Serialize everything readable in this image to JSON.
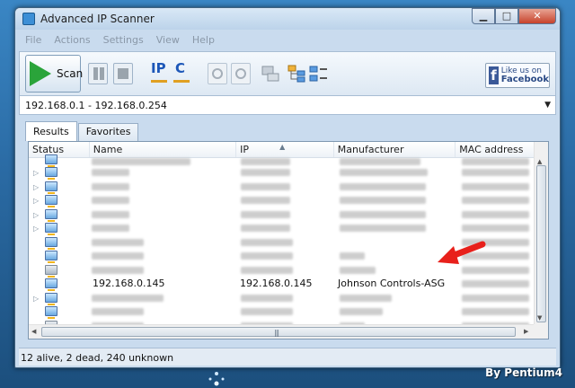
{
  "window": {
    "title": "Advanced IP Scanner"
  },
  "menu": [
    "File",
    "Actions",
    "Settings",
    "View",
    "Help"
  ],
  "toolbar": {
    "scan_label": "Scan",
    "ip_label": "IP",
    "c_label": "C",
    "facebook_line1": "Like us on",
    "facebook_line2": "Facebook",
    "facebook_logo": "f"
  },
  "range": {
    "value": "192.168.0.1 - 192.168.0.254"
  },
  "tabs": [
    {
      "label": "Results",
      "active": true
    },
    {
      "label": "Favorites",
      "active": false
    }
  ],
  "columns": [
    "Status",
    "Name",
    "IP",
    "Manufacturer",
    "MAC address"
  ],
  "highlight_row": {
    "name": "192.168.0.145",
    "ip": "192.168.0.145",
    "manufacturer": "Johnson Controls-ASG"
  },
  "status_bar": {
    "text": "12 alive, 2 dead, 240 unknown"
  },
  "watermark": "By Pentium4",
  "colors": {
    "accent_arrow": "#e8201b",
    "scan_green": "#2aa43a",
    "facebook_blue": "#3b5998"
  }
}
